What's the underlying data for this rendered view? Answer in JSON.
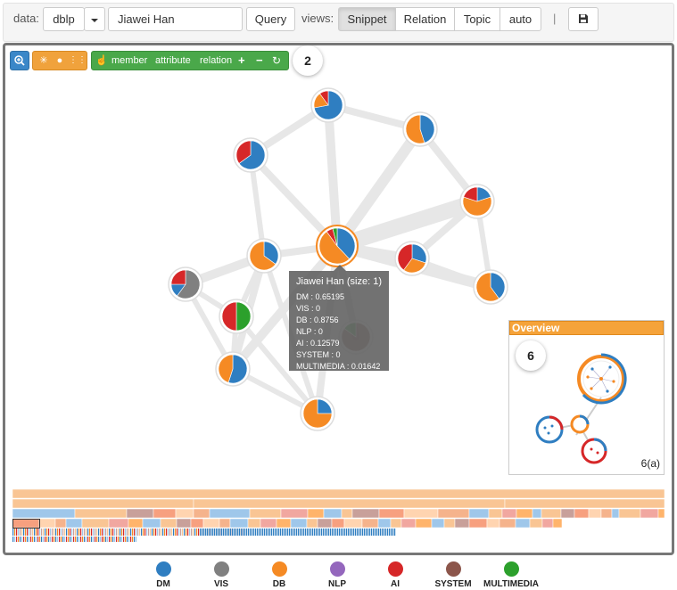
{
  "toolbar": {
    "data_label": "data:",
    "dataset": "dblp",
    "query_value": "Jiawei Han",
    "query_button": "Query",
    "views_label": "views:",
    "views": [
      "Snippet",
      "Relation",
      "Topic",
      "auto"
    ],
    "active_view": "Snippet",
    "separator": "|"
  },
  "graph_tools": {
    "member": "member",
    "attribute": "attribute",
    "relation": "relation",
    "step_badge": "2"
  },
  "tooltip": {
    "title": "Jiawei Han (size: 1)",
    "lines": [
      "DM : 0.65195",
      "VIS : 0",
      "DB : 0.8756",
      "NLP : 0",
      "AI : 0.12579",
      "SYSTEM : 0",
      "MULTIMEDIA : 0.01642"
    ]
  },
  "overview": {
    "title": "Overview",
    "badge": "6",
    "caption": "6(a)"
  },
  "legend": [
    {
      "label": "DM",
      "color": "#2f7ec1"
    },
    {
      "label": "VIS",
      "color": "#808080"
    },
    {
      "label": "DB",
      "color": "#f58a24"
    },
    {
      "label": "NLP",
      "color": "#9467bd"
    },
    {
      "label": "AI",
      "color": "#d62728"
    },
    {
      "label": "SYSTEM",
      "color": "#8c564b"
    },
    {
      "label": "MULTIMEDIA",
      "color": "#2ca02c"
    }
  ]
}
